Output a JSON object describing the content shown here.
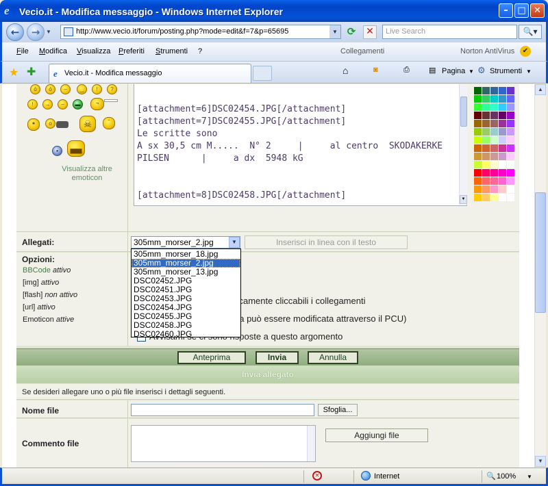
{
  "window": {
    "title": "Vecio.it - Modifica messaggio - Windows Internet Explorer",
    "logo_glyph": "e",
    "minimize": "–",
    "maximize": "□",
    "close": "✕"
  },
  "address_bar": {
    "url": "http://www.vecio.it/forum/posting.php?mode=edit&f=7&p=65695",
    "search_placeholder": "Live Search",
    "search_icon": "🔍▾"
  },
  "menu": {
    "items": [
      "File",
      "Modifica",
      "Visualizza",
      "Preferiti",
      "Strumenti",
      "?"
    ],
    "collegamenti": "Collegamenti",
    "norton": "Norton AntiVirus",
    "norton_icon": "✔"
  },
  "tabs": {
    "active": "Vecio.it - Modifica messaggio",
    "tab_icon_glyph": "e"
  },
  "toolbar": {
    "pagina": "Pagina",
    "strumenti": "Strumenti"
  },
  "emoticons": {
    "more_label": "Visualizza altre emoticon"
  },
  "message_text": "[attachment=6]DSC02454.JPG[/attachment]\n[attachment=7]DSC02455.JPG[/attachment]\nLe scritte sono\nA sx 30,5 cm M.....  N° 2     |     al centro  SKODAKERKE\nPILSEN      |     a dx  5948 kG\n\n\n[attachment=8]DSC02458.JPG[/attachment]",
  "palette_colors": [
    "#006600",
    "#336666",
    "#336699",
    "#3366cc",
    "#6633cc",
    "#00cc00",
    "#33cc66",
    "#00cccc",
    "#3399cc",
    "#6666ff",
    "#33ff33",
    "#33ff99",
    "#33ffcc",
    "#33ccff",
    "#9999ff",
    "#660000",
    "#663333",
    "#663366",
    "#660066",
    "#9900cc",
    "#996600",
    "#996633",
    "#996666",
    "#993399",
    "#9933ff",
    "#99cc00",
    "#99cc66",
    "#99cccc",
    "#9999cc",
    "#cc99ff",
    "#ccff00",
    "#99ff66",
    "#ccffcc",
    "#ccccff",
    "#ffccff",
    "#cc6600",
    "#cc6633",
    "#cc6666",
    "#cc3399",
    "#cc33ff",
    "#cc9933",
    "#cc9966",
    "#cc9999",
    "#cc99cc",
    "#ffccff",
    "#ccff33",
    "#ffff66",
    "#ffffcc",
    "#ffffff",
    "#ffffff",
    "#ff0000",
    "#ff0066",
    "#ff0099",
    "#ff00cc",
    "#ff00ff",
    "#ff6600",
    "#ff6666",
    "#ff6699",
    "#ff66cc",
    "#ff99ff",
    "#ff9900",
    "#ff9966",
    "#ff99cc",
    "#ffcccc",
    "#ffffff",
    "#ffcc00",
    "#ffcc66",
    "#ffff99",
    "#ffffff",
    "#ffffff"
  ],
  "form": {
    "allegati_label": "Allegati:",
    "selected_attachment": "305mm_morser_2.jpg",
    "inline_button": "Inserisci in linea con il testo",
    "attachment_options": [
      "305mm_morser_18.jpg",
      "305mm_morser_2.jpg",
      "305mm_morser_13.jpg",
      "DSC02452.JPG",
      "DSC02451.JPG",
      "DSC02453.JPG",
      "DSC02454.JPG",
      "DSC02455.JPG",
      "DSC02458.JPG",
      "DSC02460.JPG"
    ],
    "opzioni_label": "Opzioni:",
    "options": {
      "bbcode_name": "BBCode",
      "bbcode_state": "attivo",
      "img_name": "[img]",
      "img_state": "attivo",
      "flash_name": "[flash]",
      "flash_state": "non attivo",
      "url_name": "[url]",
      "url_state": "attivo",
      "emoticon_name": "Emoticon",
      "emoticon_state": "attive"
    },
    "checkbox_links": "ticamente cliccabili i collegamenti",
    "checkbox_sig": "na può essere modificata attraverso il PCU)",
    "checkbox_notify": "Avvisami se ci sono risposte a questo argomento",
    "btn_preview": "Anteprima",
    "btn_send": "Invia",
    "btn_cancel": "Annulla",
    "invia_allegato": "Invia allegato",
    "info": "Se desideri allegare uno o più file inserisci i dettagli seguenti.",
    "nome_file_label": "Nome file",
    "sfoglia": "Sfoglia...",
    "commento_label": "Commento file",
    "aggiungi": "Aggiungi file"
  },
  "status": {
    "zone": "Internet",
    "zoom": "100%",
    "zoom_icon": "🔍"
  }
}
